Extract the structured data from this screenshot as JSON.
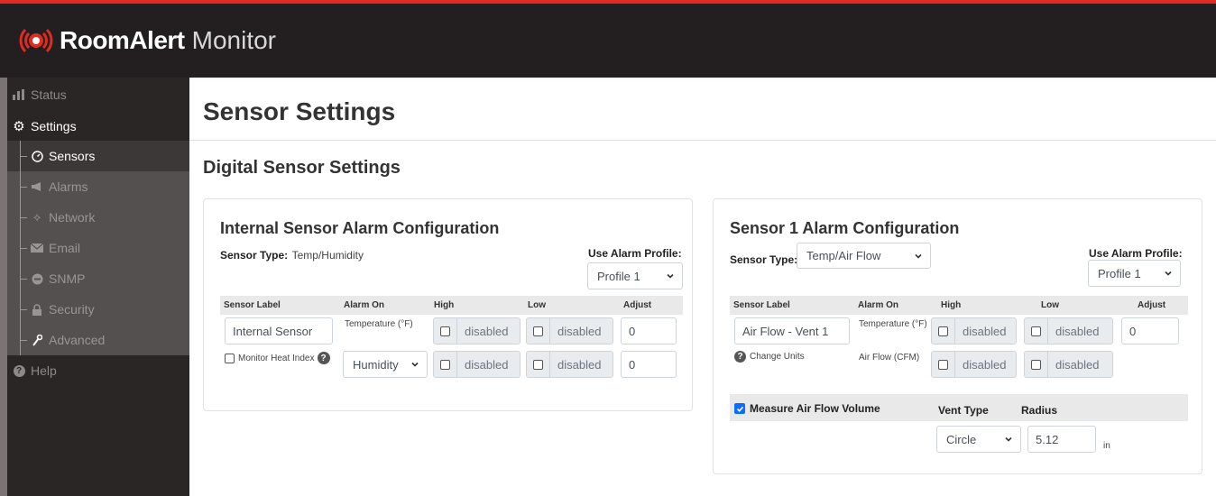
{
  "header": {
    "brand": "RoomAlert",
    "subtitle": "Monitor"
  },
  "sidebar": {
    "status": "Status",
    "settings": "Settings",
    "sub_items": [
      "Sensors",
      "Alarms",
      "Network",
      "Email",
      "SNMP",
      "Security",
      "Advanced"
    ],
    "help": "Help"
  },
  "main": {
    "page_title": "Sensor Settings",
    "section_title": "Digital Sensor Settings"
  },
  "internal": {
    "title": "Internal Sensor Alarm Configuration",
    "sensor_type_label": "Sensor Type:",
    "sensor_type_value": "Temp/Humidity",
    "use_profile_label": "Use Alarm Profile:",
    "profile_value": "Profile 1",
    "columns": [
      "Sensor Label",
      "Alarm On",
      "High",
      "Low",
      "Adjust"
    ],
    "sensor_label_value": "Internal Sensor",
    "row1_alarm_on": "Temperature (°F)",
    "row1_high": "disabled",
    "row1_low": "disabled",
    "row1_adjust": "0",
    "monitor_heat_index": "Monitor Heat Index",
    "row2_alarm_on": "Humidity",
    "row2_high": "disabled",
    "row2_low": "disabled",
    "row2_adjust": "0"
  },
  "sensor1": {
    "title": "Sensor 1 Alarm Configuration",
    "sensor_type_label": "Sensor Type:",
    "sensor_type_value": "Temp/Air Flow",
    "use_profile_label": "Use Alarm Profile:",
    "profile_value": "Profile 1",
    "columns": [
      "Sensor Label",
      "Alarm On",
      "High",
      "Low",
      "Adjust"
    ],
    "sensor_label_value": "Air Flow - Vent 1",
    "row1_alarm_on": "Temperature (°F)",
    "row1_high": "disabled",
    "row1_low": "disabled",
    "row1_adjust": "0",
    "change_units": "Change Units",
    "row2_alarm_on": "Air Flow (CFM)",
    "row2_high": "disabled",
    "row2_low": "disabled",
    "measure_label": "Measure Air Flow Volume",
    "vent_type_label": "Vent Type",
    "radius_label": "Radius",
    "vent_type_value": "Circle",
    "radius_value": "5.12",
    "radius_unit": "in"
  },
  "colors": {
    "accent_red": "#e02b20",
    "header_bg": "#231f20",
    "sidebar_bg": "#2b2626",
    "check_blue": "#0d6efd"
  }
}
